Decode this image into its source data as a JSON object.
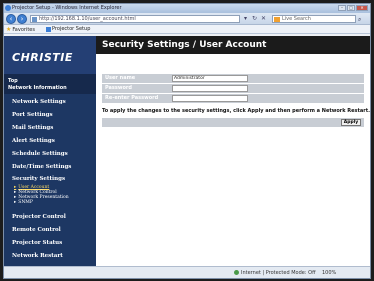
{
  "window": {
    "title": "Projector Setup - Windows Internet Explorer",
    "address_url": "http://192.168.1.10/user_account.html",
    "search_placeholder": "Live Search"
  },
  "favorites": {
    "label": "Favorites",
    "tab_label": "Projector Setup"
  },
  "sidebar": {
    "logo": "CHRISTIE",
    "top_line1": "Top",
    "top_line2": "Network Information",
    "items": [
      "Network Settings",
      "Port Settings",
      "Mail Settings",
      "Alert Settings",
      "Schedule Settings",
      "Date/Time Settings",
      "Security Settings",
      "Projector Control",
      "Remote Control",
      "Projector Status",
      "Network Restart"
    ],
    "subitems": [
      "User Account",
      "Network Control",
      "Network Presentation",
      "SNMP"
    ]
  },
  "main": {
    "header": "Security Settings / User Account",
    "form": {
      "user_name_label": "User name",
      "user_name_value": "Administrator",
      "password_label": "Password",
      "reenter_label": "Re-enter Password"
    },
    "note": "To apply the changes to the security settings, click Apply and then perform a Network Restart.",
    "apply_label": "Apply"
  },
  "statusbar": {
    "zone": "Internet | Protected Mode: Off",
    "zoom": "100%"
  },
  "colors": {
    "sidebar": "#1d3763",
    "header": "#1b1b1b",
    "row": "#c8cdd4"
  }
}
